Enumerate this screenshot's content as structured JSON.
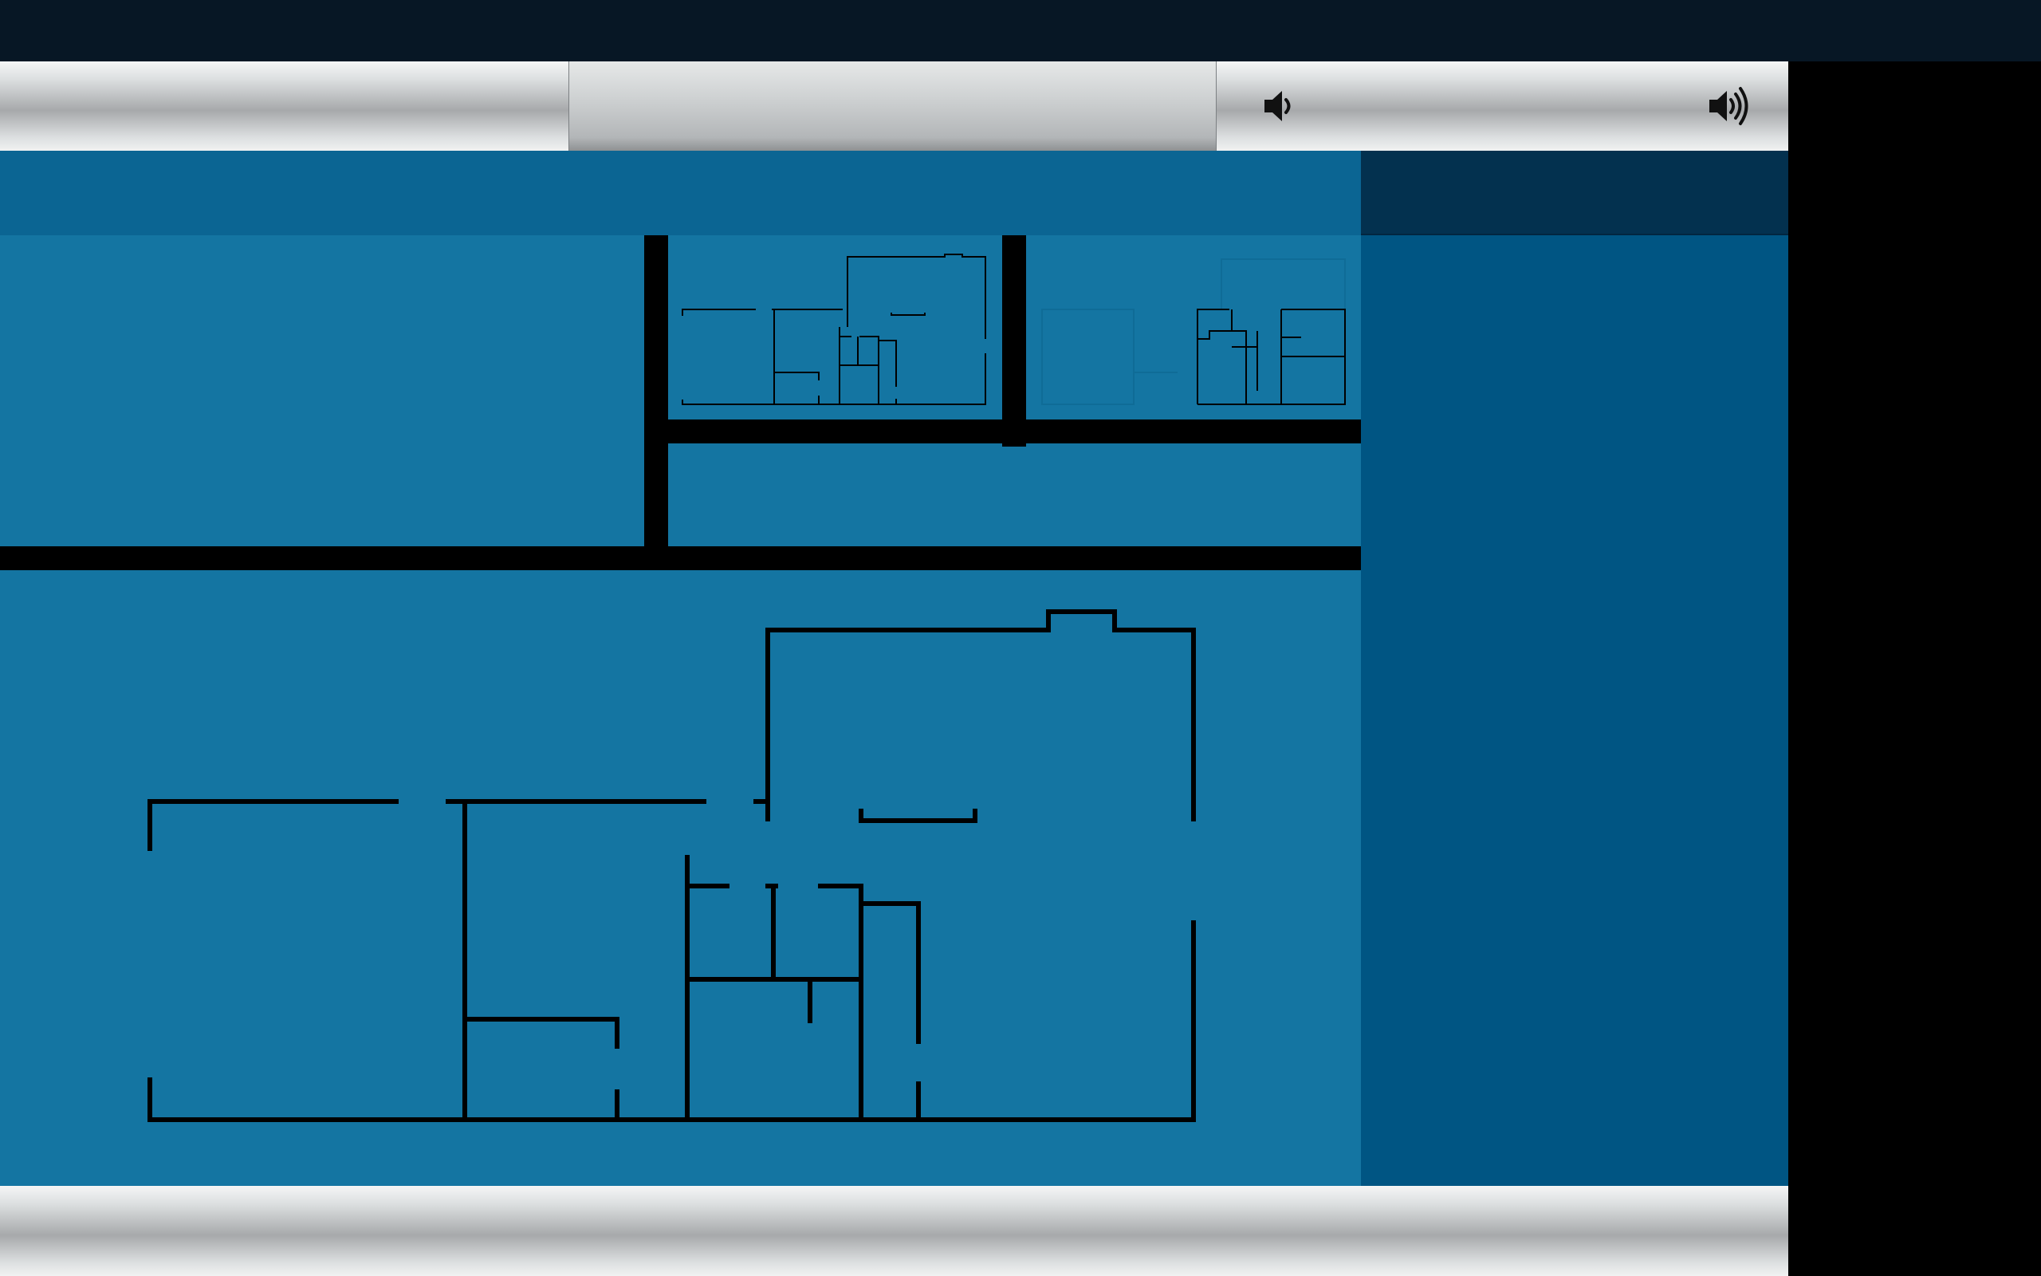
{
  "colors": {
    "top_bar": "#071725",
    "main_background": "#1475a2",
    "main_header": "#0b6593",
    "side_panel": "#005583",
    "side_header": "#03314f",
    "wall_color": "#000000"
  },
  "toolbar": {
    "volume_low_icon": "speaker-low-icon",
    "volume_high_icon": "speaker-high-icon",
    "volume_level": 0.0
  },
  "level_selector": {
    "thumbnails": [
      {
        "id": "level-1",
        "state": "active"
      },
      {
        "id": "level-2",
        "state": "dimmed"
      }
    ]
  },
  "floorplan": {
    "description_icon": "floorplan-icon"
  }
}
